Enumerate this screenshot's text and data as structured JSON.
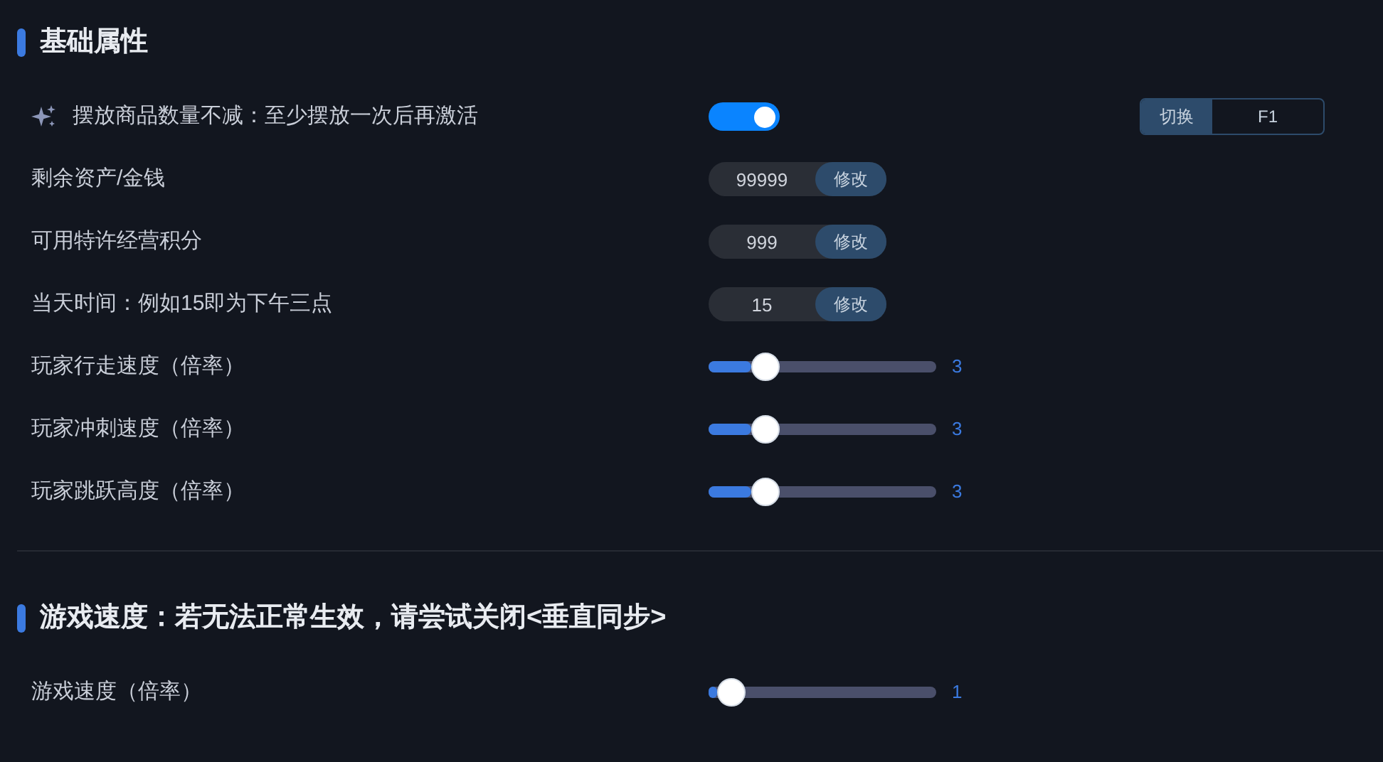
{
  "sections": [
    {
      "title": "基础属性",
      "rows": [
        {
          "kind": "toggle",
          "label": "摆放商品数量不减：至少摆放一次后再激活",
          "icon": true,
          "on": true,
          "hotkey": {
            "action": "切换",
            "key": "F1"
          }
        },
        {
          "kind": "input",
          "label": "剩余资产/金钱",
          "value": "99999",
          "button": "修改"
        },
        {
          "kind": "input",
          "label": "可用特许经营积分",
          "value": "999",
          "button": "修改"
        },
        {
          "kind": "input",
          "label": "当天时间：例如15即为下午三点",
          "value": "15",
          "button": "修改"
        },
        {
          "kind": "slider",
          "label": "玩家行走速度（倍率）",
          "level": 0.25,
          "reading": "3"
        },
        {
          "kind": "slider",
          "label": "玩家冲刺速度（倍率）",
          "level": 0.25,
          "reading": "3"
        },
        {
          "kind": "slider",
          "label": "玩家跳跃高度（倍率）",
          "level": 0.25,
          "reading": "3"
        }
      ]
    },
    {
      "title": "游戏速度：若无法正常生效，请尝试关闭<垂直同步>",
      "rows": [
        {
          "kind": "slider",
          "label": "游戏速度（倍率）",
          "level": 0.1,
          "reading": "1"
        }
      ]
    }
  ]
}
